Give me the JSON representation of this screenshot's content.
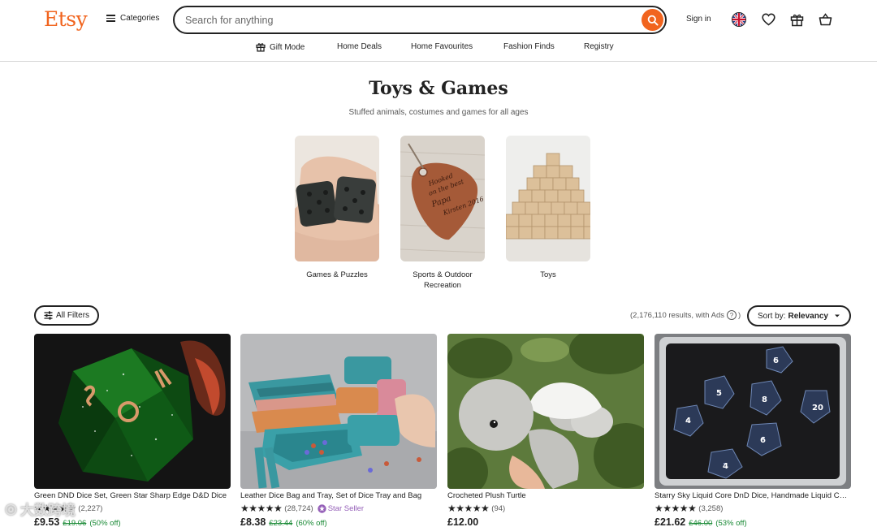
{
  "header": {
    "logo": "Etsy",
    "categories_label": "Categories",
    "search_placeholder": "Search for anything",
    "signin_label": "Sign in"
  },
  "nav": {
    "items": [
      "Gift Mode",
      "Home Deals",
      "Home Favourites",
      "Fashion Finds",
      "Registry"
    ]
  },
  "hero": {
    "title": "Toys & Games",
    "subtitle": "Stuffed animals, costumes and games for all ages"
  },
  "categories": [
    {
      "label": "Games & Puzzles"
    },
    {
      "label": "Sports & Outdoor Recreation"
    },
    {
      "label": "Toys"
    }
  ],
  "filters": {
    "all_filters_label": "All Filters",
    "results_text": "(2,176,110 results, with Ads",
    "sort_prefix": "Sort by:",
    "sort_value": "Relevancy"
  },
  "products": [
    {
      "title": "Green DND Dice Set, Green Star Sharp Edge D&D Dice",
      "reviews": "(2,227)",
      "price": "£9.53",
      "original": "£19.06",
      "discount": "(50% off)",
      "star_seller": ""
    },
    {
      "title": "Leather Dice Bag and Tray, Set of Dice Tray and Bag",
      "reviews": "(28,724)",
      "price": "£8.38",
      "original": "£23.44",
      "discount": "(60% off)",
      "star_seller": "Star Seller"
    },
    {
      "title": "Crocheted Plush Turtle",
      "reviews": "(94)",
      "price": "£12.00",
      "original": "",
      "discount": "",
      "star_seller": ""
    },
    {
      "title": "Starry Sky Liquid Core DnD Dice, Handmade Liquid Core Dice",
      "reviews": "(3,258)",
      "price": "£21.62",
      "original": "£46.00",
      "discount": "(53% off)",
      "star_seller": ""
    }
  ],
  "stars": "★★★★★",
  "watermark": "大数跨境",
  "colors": {
    "brand": "#f1641e",
    "sale_green": "#1a8a36",
    "star_seller_purple": "#9560b8"
  },
  "icons": [
    "hamburger-icon",
    "search-icon",
    "uk-flag-icon",
    "heart-icon",
    "gift-icon",
    "basket-icon",
    "filter-icon",
    "chevron-down-icon",
    "star-seller-badge-icon",
    "help-circle-icon"
  ]
}
